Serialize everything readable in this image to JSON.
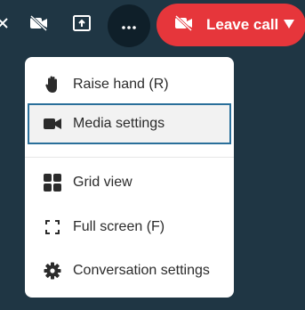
{
  "toolbar": {
    "icons": [
      "partial-icon",
      "video-off-icon",
      "share-screen-icon"
    ],
    "more_icon": "more-dots-icon",
    "leave_button": {
      "label": "Leave call",
      "icon": "video-off-icon",
      "caret": "caret-down-icon",
      "color": "#e6363b"
    }
  },
  "menu": {
    "items": [
      {
        "label": "Raise hand (R)",
        "icon": "raise-hand-icon"
      },
      {
        "label": "Media settings",
        "icon": "camera-icon",
        "selected": true
      },
      {
        "label": "Grid view",
        "icon": "grid-icon"
      },
      {
        "label": "Full screen (F)",
        "icon": "fullscreen-icon"
      },
      {
        "label": "Conversation settings",
        "icon": "gear-icon"
      }
    ]
  },
  "colors": {
    "background": "#1f3644",
    "selection_border": "#2a6f9a"
  }
}
